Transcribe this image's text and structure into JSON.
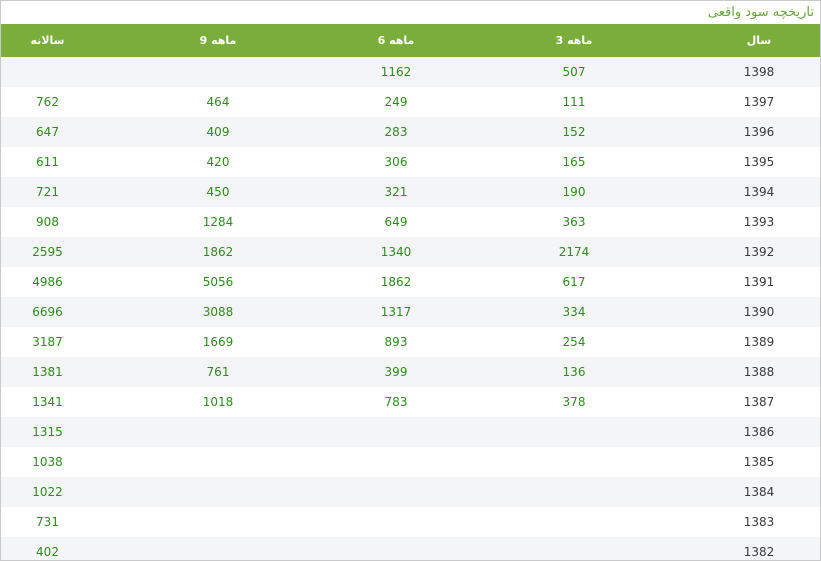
{
  "panel": {
    "title": "تاریخچه سود واقعی"
  },
  "table": {
    "headers": {
      "annual": "سالانه",
      "nine_month": "9 ماهه",
      "six_month": "6 ماهه",
      "three_month": "3 ماهه",
      "year": "سال"
    },
    "rows": [
      {
        "year": "1398",
        "q3": "507",
        "q6": "1162",
        "q9": "",
        "annual": ""
      },
      {
        "year": "1397",
        "q3": "111",
        "q6": "249",
        "q9": "464",
        "annual": "762"
      },
      {
        "year": "1396",
        "q3": "152",
        "q6": "283",
        "q9": "409",
        "annual": "647"
      },
      {
        "year": "1395",
        "q3": "165",
        "q6": "306",
        "q9": "420",
        "annual": "611"
      },
      {
        "year": "1394",
        "q3": "190",
        "q6": "321",
        "q9": "450",
        "annual": "721"
      },
      {
        "year": "1393",
        "q3": "363",
        "q6": "649",
        "q9": "1284",
        "annual": "908"
      },
      {
        "year": "1392",
        "q3": "2174",
        "q6": "1340",
        "q9": "1862",
        "annual": "2595"
      },
      {
        "year": "1391",
        "q3": "617",
        "q6": "1862",
        "q9": "5056",
        "annual": "4986"
      },
      {
        "year": "1390",
        "q3": "334",
        "q6": "1317",
        "q9": "3088",
        "annual": "6696"
      },
      {
        "year": "1389",
        "q3": "254",
        "q6": "893",
        "q9": "1669",
        "annual": "3187"
      },
      {
        "year": "1388",
        "q3": "136",
        "q6": "399",
        "q9": "761",
        "annual": "1381"
      },
      {
        "year": "1387",
        "q3": "378",
        "q6": "783",
        "q9": "1018",
        "annual": "1341"
      },
      {
        "year": "1386",
        "q3": "",
        "q6": "",
        "q9": "",
        "annual": "1315"
      },
      {
        "year": "1385",
        "q3": "",
        "q6": "",
        "q9": "",
        "annual": "1038"
      },
      {
        "year": "1384",
        "q3": "",
        "q6": "",
        "q9": "",
        "annual": "1022"
      },
      {
        "year": "1383",
        "q3": "",
        "q6": "",
        "q9": "",
        "annual": "731"
      },
      {
        "year": "1382",
        "q3": "",
        "q6": "",
        "q9": "",
        "annual": "402"
      }
    ]
  },
  "colors": {
    "header_bg": "#7aad3c",
    "title_text": "#6aa33a",
    "value_text": "#2f8a1f",
    "stripe_bg": "#f4f5f7"
  }
}
